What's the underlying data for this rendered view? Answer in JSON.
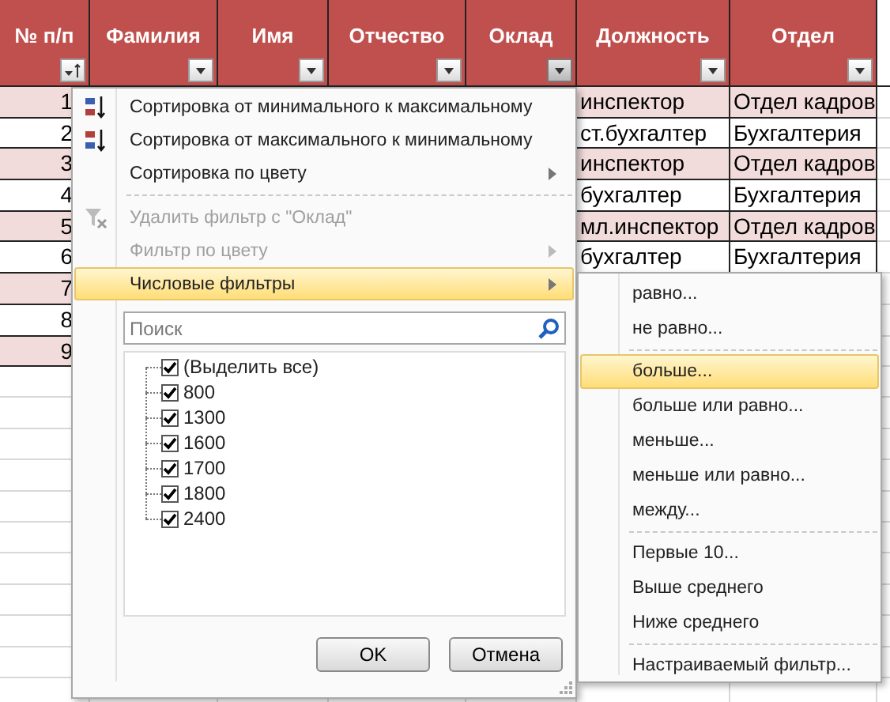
{
  "table": {
    "columns": [
      {
        "label": "№ п/п",
        "kind": "sort",
        "active": false
      },
      {
        "label": "Фамилия",
        "kind": "dropdown",
        "active": false
      },
      {
        "label": "Имя",
        "kind": "dropdown",
        "active": false
      },
      {
        "label": "Отчество",
        "kind": "dropdown",
        "active": false
      },
      {
        "label": "Оклад",
        "kind": "dropdown",
        "active": true
      },
      {
        "label": "Должность",
        "kind": "dropdown",
        "active": false
      },
      {
        "label": "Отдел",
        "kind": "dropdown",
        "active": false
      }
    ],
    "rows": [
      {
        "number": "1",
        "highlighted": true,
        "position": "инспектор",
        "department": "Отдел кадров"
      },
      {
        "number": "2",
        "highlighted": false,
        "position": "ст.бухгалтер",
        "department": "Бухгалтерия"
      },
      {
        "number": "3",
        "highlighted": true,
        "position": "инспектор",
        "department": "Отдел кадров"
      },
      {
        "number": "4",
        "highlighted": false,
        "position": "бухгалтер",
        "department": "Бухгалтерия"
      },
      {
        "number": "5",
        "highlighted": true,
        "position": "мл.инспектор",
        "department": "Отдел кадров"
      },
      {
        "number": "6",
        "highlighted": false,
        "position": "бухгалтер",
        "department": "Бухгалтерия"
      },
      {
        "number": "7",
        "highlighted": true
      },
      {
        "number": "8",
        "highlighted": false
      },
      {
        "number": "9",
        "highlighted": true
      }
    ]
  },
  "filter_menu": {
    "groups": [
      {
        "items": [
          {
            "label": "Сортировка от минимального к максимальному",
            "kind": "sort_ascending",
            "disabled": false,
            "has_submenu": false,
            "selected": false
          },
          {
            "label": "Сортировка от максимального к минимальному",
            "kind": "sort_descending",
            "disabled": false,
            "has_submenu": false,
            "selected": false
          },
          {
            "label": "Сортировка по цвету",
            "kind": "plain",
            "disabled": false,
            "has_submenu": true,
            "selected": false
          }
        ]
      },
      {
        "items": [
          {
            "label": "Удалить фильтр с \"Оклад\"",
            "kind": "clear_filter",
            "disabled": true,
            "has_submenu": false,
            "selected": false
          },
          {
            "label": "Фильтр по цвету",
            "kind": "plain",
            "disabled": true,
            "has_submenu": true,
            "selected": false
          },
          {
            "label": "Числовые фильтры",
            "kind": "plain",
            "disabled": false,
            "has_submenu": true,
            "selected": true
          }
        ]
      }
    ],
    "search": {
      "placeholder": "Поиск"
    },
    "values": [
      {
        "label": "(Выделить все)",
        "checked": true
      },
      {
        "label": "800",
        "checked": true
      },
      {
        "label": "1300",
        "checked": true
      },
      {
        "label": "1600",
        "checked": true
      },
      {
        "label": "1700",
        "checked": true
      },
      {
        "label": "1800",
        "checked": true
      },
      {
        "label": "2400",
        "checked": true
      }
    ],
    "buttons": [
      {
        "label": "OK"
      },
      {
        "label": "Отмена"
      }
    ]
  },
  "number_filters_menu": {
    "groups": [
      {
        "items": [
          {
            "label": "равно...",
            "selected": false
          },
          {
            "label": "не равно...",
            "selected": false
          }
        ]
      },
      {
        "items": [
          {
            "label": "больше...",
            "selected": true
          },
          {
            "label": "больше или равно...",
            "selected": false
          },
          {
            "label": "меньше...",
            "selected": false
          },
          {
            "label": "меньше или равно...",
            "selected": false
          },
          {
            "label": "между...",
            "selected": false
          }
        ]
      },
      {
        "items": [
          {
            "label": "Первые 10...",
            "selected": false
          },
          {
            "label": "Выше среднего",
            "selected": false
          },
          {
            "label": "Ниже среднего",
            "selected": false
          }
        ]
      },
      {
        "items": [
          {
            "label": "Настраиваемый фильтр...",
            "selected": false
          }
        ]
      }
    ]
  }
}
